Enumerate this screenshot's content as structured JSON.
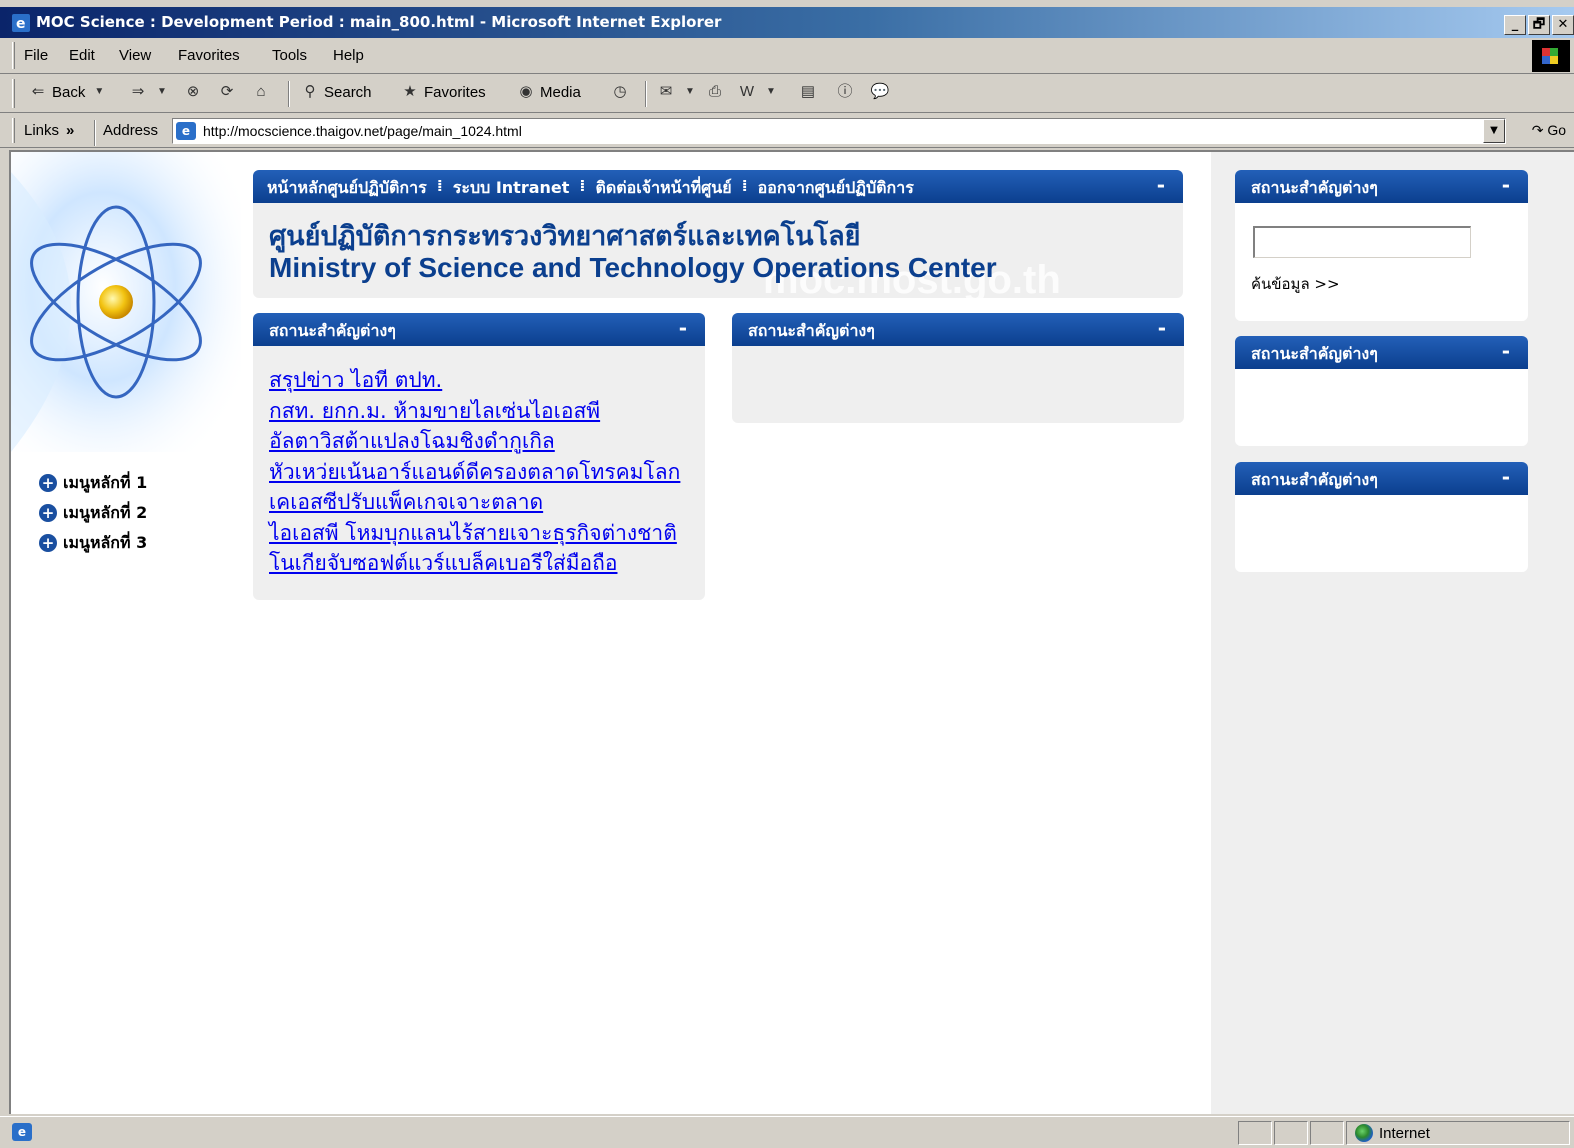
{
  "window": {
    "title": "MOC Science : Development Period : main_800.html - Microsoft Internet Explorer",
    "controls": [
      "_",
      "🗗",
      "✕"
    ]
  },
  "menubar": [
    "File",
    "Edit",
    "View",
    "Favorites",
    "Tools",
    "Help"
  ],
  "toolbar": {
    "back": "Back",
    "search": "Search",
    "favorites": "Favorites",
    "media": "Media"
  },
  "addressbar": {
    "links": "Links",
    "links_chevron": "»",
    "address_label": "Address",
    "url": "http://mocscience.thaigov.net/page/main_1024.html",
    "go": "Go"
  },
  "page": {
    "topnav": [
      "หน้าหลักศูนย์ปฏิบัติการ",
      "ระบบ Intranet",
      "ติดต่อเจ้าหน้าที่ศูนย์",
      "ออกจากศูนย์ปฏิบัติการ"
    ],
    "header_title_th": "ศูนย์ปฏิบัติการกระทรวงวิทยาศาสตร์และเทคโนโลยี",
    "header_title_en": "Ministry of Science and Technology Operations Center",
    "watermark": "moc.most.go.th",
    "left_menu": [
      "เมนูหลักที่ 1",
      "เมนูหลักที่ 2",
      "เมนูหลักที่ 3"
    ],
    "panel_title": "สถานะสำคัญต่างๆ",
    "minimize": "-",
    "news": [
      "สรุปข่าว ไอที ตปท.",
      "กสท. ยกก.ม. ห้ามขายไลเซ่นไอเอสพี",
      "อัลตาวิสต้าแปลงโฉมชิงดำกูเกิล",
      "หัวเหว่ยเน้นอาร์แอนด์ดีครองตลาดโทรคมโลก",
      "เคเอสซีปรับแพ็คเกจเจาะตลาด",
      "ไอเอสพี โหมบุกแลนไร้สายเจาะธุรกิจต่างชาติ",
      "โนเกียจับซอฟต์แวร์แบล็คเบอรีใส่มือถือ"
    ],
    "search_value": "",
    "search_link": "ค้นข้อมูล >>"
  },
  "statusbar": {
    "zone": "Internet"
  }
}
